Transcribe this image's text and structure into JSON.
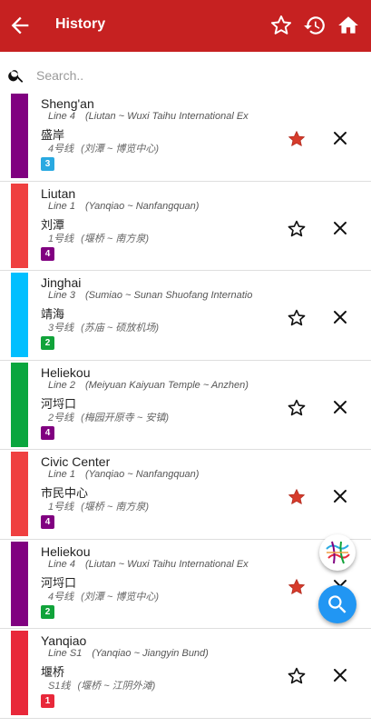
{
  "header": {
    "title": "History",
    "back_icon": "arrow-left-icon",
    "favorites_icon": "star-outline-icon",
    "history_icon": "history-icon",
    "home_icon": "home-icon",
    "background": "#c62121"
  },
  "search": {
    "placeholder": "Search..",
    "icon": "search-icon"
  },
  "items": [
    {
      "name_en": "Sheng'an",
      "line_en": "Line 4",
      "route_en": "(Liutan ~ Wuxi Taihu International Ex",
      "name_zh": "盛岸",
      "line_zh": "4号线",
      "route_zh": "(刘潭 ~ 博览中心)",
      "badge": "3",
      "badge_color": "#29a9e1",
      "line_color": "#800080",
      "starred": true
    },
    {
      "name_en": "Liutan",
      "line_en": "Line 1",
      "route_en": "(Yanqiao ~ Nanfangquan)",
      "name_zh": "刘潭",
      "line_zh": "1号线",
      "route_zh": "(堰桥 ~ 南方泉)",
      "badge": "4",
      "badge_color": "#800080",
      "line_color": "#ef4040",
      "starred": false
    },
    {
      "name_en": "Jinghai",
      "line_en": "Line 3",
      "route_en": "(Sumiao ~ Sunan Shuofang Internatio",
      "name_zh": "靖海",
      "line_zh": "3号线",
      "route_zh": "(苏庙 ~ 硕放机场)",
      "badge": "2",
      "badge_color": "#11a33a",
      "line_color": "#00bfff",
      "starred": false
    },
    {
      "name_en": "Heliekou",
      "line_en": "Line 2",
      "route_en": "(Meiyuan Kaiyuan Temple ~ Anzhen)",
      "name_zh": "河埒口",
      "line_zh": "2号线",
      "route_zh": "(梅园开原寺 ~ 安镇)",
      "badge": "4",
      "badge_color": "#800080",
      "line_color": "#0aa63e",
      "starred": false
    },
    {
      "name_en": "Civic Center",
      "line_en": "Line 1",
      "route_en": "(Yanqiao ~ Nanfangquan)",
      "name_zh": "市民中心",
      "line_zh": "1号线",
      "route_zh": "(堰桥 ~ 南方泉)",
      "badge": "4",
      "badge_color": "#800080",
      "line_color": "#ef4040",
      "starred": true
    },
    {
      "name_en": "Heliekou",
      "line_en": "Line 4",
      "route_en": "(Liutan ~ Wuxi Taihu International Ex",
      "name_zh": "河埒口",
      "line_zh": "4号线",
      "route_zh": "(刘潭 ~ 博览中心)",
      "badge": "2",
      "badge_color": "#11a33a",
      "line_color": "#800080",
      "starred": true
    },
    {
      "name_en": "Yanqiao",
      "line_en": "Line S1",
      "route_en": "(Yanqiao ~ Jiangyin Bund)",
      "name_zh": "堰桥",
      "line_zh": "S1线",
      "route_zh": "(堰桥 ~ 江阴外滩)",
      "badge": "1",
      "badge_color": "#e8283a",
      "line_color": "#e8283a",
      "starred": false
    }
  ],
  "fab": {
    "map_icon": "metro-map-icon",
    "search_icon": "search-icon",
    "search_color": "#2196f3"
  }
}
